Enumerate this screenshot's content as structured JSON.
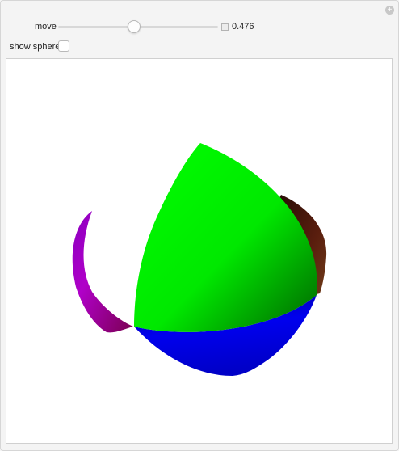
{
  "controls": {
    "move": {
      "label": "move",
      "value": 0.476,
      "value_text": "0.476",
      "min": 0,
      "max": 1,
      "thumb_position_fraction": 0.47
    },
    "show_sphere": {
      "label": "show sphere",
      "checked": false
    }
  },
  "icons": {
    "corner": "plus-circle-icon",
    "slider_step": "plus-icon"
  },
  "colors": {
    "green": "#00ff00",
    "blue": "#0000ee",
    "brown": "#5a1e0e",
    "magenta": "#9b00b0"
  }
}
